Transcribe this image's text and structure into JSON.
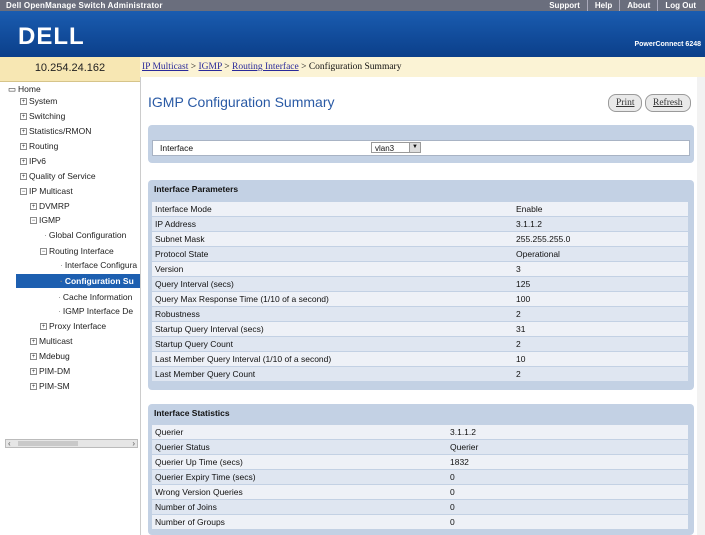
{
  "topbar": {
    "title": "Dell OpenManage Switch Administrator",
    "links": [
      "Support",
      "Help",
      "About",
      "Log Out"
    ]
  },
  "banner": {
    "logo": "DELL",
    "product": "PowerConnect 6248"
  },
  "ip": "10.254.24.162",
  "breadcrumb": {
    "links": [
      "IP Multicast",
      "IGMP",
      "Routing Interface"
    ],
    "sep": " > ",
    "current": "Configuration Summary"
  },
  "page": {
    "title": "IGMP Configuration Summary",
    "print_label": "Print",
    "refresh_label": "Refresh"
  },
  "nav": {
    "items": [
      {
        "label": "Home",
        "icon": "home-icon"
      },
      {
        "label": "System",
        "icon": "expand-icon"
      },
      {
        "label": "Switching",
        "icon": "expand-icon"
      },
      {
        "label": "Statistics/RMON",
        "icon": "expand-icon"
      },
      {
        "label": "Routing",
        "icon": "expand-icon"
      },
      {
        "label": "IPv6",
        "icon": "expand-icon"
      },
      {
        "label": "Quality of Service",
        "icon": "expand-icon"
      },
      {
        "label": "IP Multicast",
        "icon": "collapse-icon"
      },
      {
        "label": "DVMRP",
        "icon": "expand-icon"
      },
      {
        "label": "IGMP",
        "icon": "collapse-icon"
      },
      {
        "label": "Global Configuration",
        "icon": "tree-line-icon"
      },
      {
        "label": "Routing Interface",
        "icon": "collapse-icon"
      },
      {
        "label": "Interface Configura",
        "icon": "tree-line-icon"
      },
      {
        "label": "Configuration Su",
        "icon": "tree-line-icon"
      },
      {
        "label": "Cache Information",
        "icon": "tree-line-icon"
      },
      {
        "label": "IGMP Interface De",
        "icon": "tree-line-icon"
      },
      {
        "label": "Proxy Interface",
        "icon": "expand-icon"
      },
      {
        "label": "Multicast",
        "icon": "expand-icon"
      },
      {
        "label": "Mdebug",
        "icon": "expand-icon"
      },
      {
        "label": "PIM-DM",
        "icon": "expand-icon"
      },
      {
        "label": "PIM-SM",
        "icon": "expand-icon"
      }
    ],
    "selected": "Configuration Su"
  },
  "interface_select": {
    "label": "Interface",
    "value": "vlan3"
  },
  "interface_parameters": {
    "title": "Interface Parameters",
    "rows": [
      {
        "k": "Interface Mode",
        "v": "Enable"
      },
      {
        "k": "IP Address",
        "v": "3.1.1.2"
      },
      {
        "k": "Subnet Mask",
        "v": "255.255.255.0"
      },
      {
        "k": "Protocol State",
        "v": "Operational"
      },
      {
        "k": "Version",
        "v": "3"
      },
      {
        "k": "Query Interval (secs)",
        "v": "125"
      },
      {
        "k": "Query Max Response Time (1/10 of a second)",
        "v": "100"
      },
      {
        "k": "Robustness",
        "v": "2"
      },
      {
        "k": "Startup Query Interval (secs)",
        "v": "31"
      },
      {
        "k": "Startup Query Count",
        "v": "2"
      },
      {
        "k": "Last Member Query Interval (1/10 of a second)",
        "v": "10"
      },
      {
        "k": "Last Member Query Count",
        "v": "2"
      }
    ]
  },
  "interface_statistics": {
    "title": "Interface Statistics",
    "rows": [
      {
        "k": "Querier",
        "v": "3.1.1.2"
      },
      {
        "k": "Querier Status",
        "v": "Querier"
      },
      {
        "k": "Querier Up Time (secs)",
        "v": "1832"
      },
      {
        "k": "Querier Expiry Time (secs)",
        "v": "0"
      },
      {
        "k": "Wrong Version Queries",
        "v": "0"
      },
      {
        "k": "Number of Joins",
        "v": "0"
      },
      {
        "k": "Number of Groups",
        "v": "0"
      }
    ]
  }
}
